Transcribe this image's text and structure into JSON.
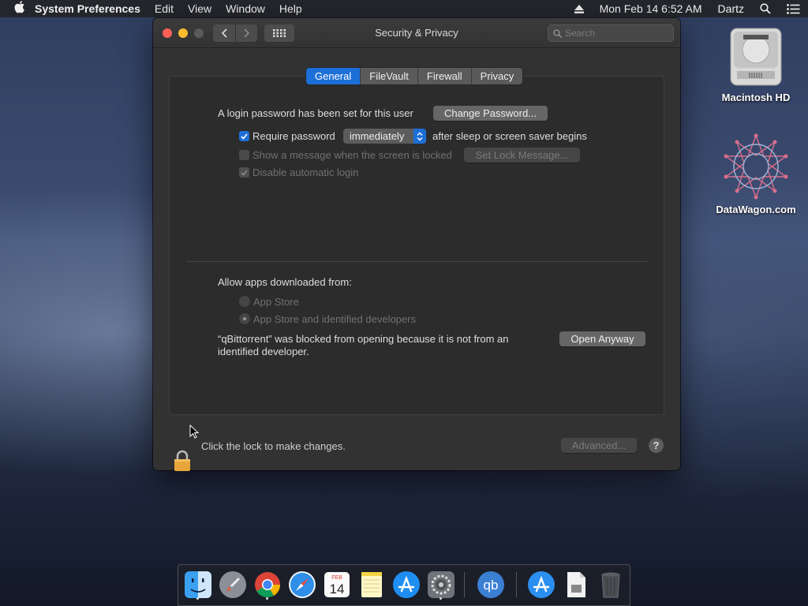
{
  "menubar": {
    "app_name": "System Preferences",
    "items": [
      "Edit",
      "View",
      "Window",
      "Help"
    ],
    "clock": "Mon Feb 14  6:52 AM",
    "user": "Dartz"
  },
  "window": {
    "title": "Security & Privacy",
    "search_placeholder": "Search"
  },
  "tabs": [
    "General",
    "FileVault",
    "Firewall",
    "Privacy"
  ],
  "active_tab": "General",
  "general": {
    "login_text": "A login password has been set for this user",
    "change_password_label": "Change Password...",
    "require_password_label": "Require password",
    "require_password_checked": true,
    "require_select_value": "immediately",
    "after_sleep_text": "after sleep or screen saver begins",
    "show_message_label": "Show a message when the screen is locked",
    "show_message_checked": false,
    "set_lock_message_label": "Set Lock Message...",
    "disable_auto_login_label": "Disable automatic login",
    "disable_auto_login_checked": true
  },
  "gatekeeper": {
    "heading": "Allow apps downloaded from:",
    "options": [
      "App Store",
      "App Store and identified developers"
    ],
    "selected": "App Store and identified developers",
    "blocked_line1": "“qBittorrent” was blocked from opening because it is not from an",
    "blocked_line2": "identified developer.",
    "open_anyway_label": "Open Anyway"
  },
  "footer": {
    "lock_text": "Click the lock to make changes.",
    "advanced_label": "Advanced...",
    "help_label": "?"
  },
  "desktop": {
    "icons": [
      "Macintosh HD",
      "DataWagon.com"
    ]
  },
  "dock": {
    "calendar_month": "FEB",
    "calendar_day": "14",
    "qbittorrent_text": "qb"
  },
  "colors": {
    "accent": "#1d6fd8",
    "close": "#fe5f57",
    "minimize": "#febc2e",
    "lock": "#e8a53a"
  }
}
